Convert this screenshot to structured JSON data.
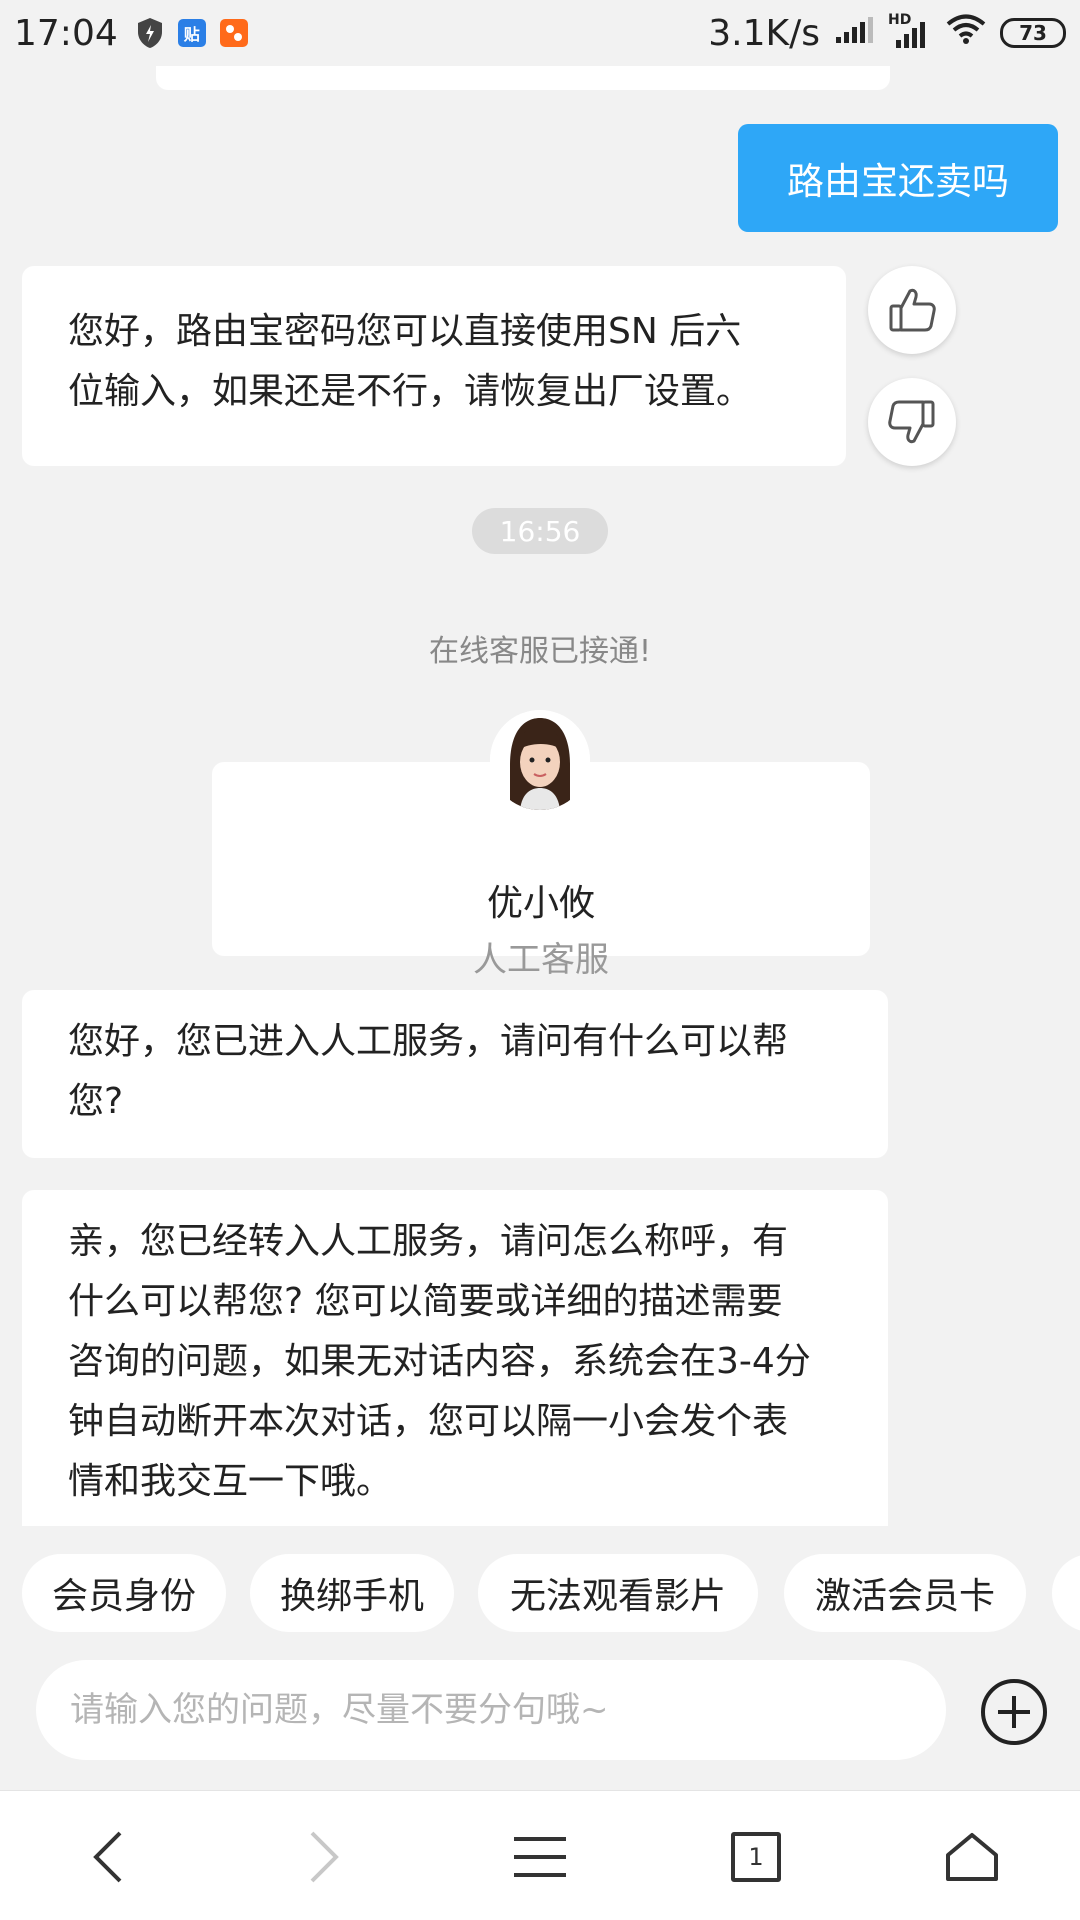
{
  "status_bar": {
    "time": "17:04",
    "network_speed": "3.1K/s",
    "battery": "73",
    "signal_label": "HD",
    "app_icons": [
      "shield-icon",
      "tieba-icon",
      "app-icon"
    ],
    "tieba_glyph": "贴"
  },
  "chat": {
    "user_message": "路由宝还卖吗",
    "bot_reply_line1": "您好，路由宝密码您可以直接使用SN 后六",
    "bot_reply_line2": "位输入，如果还是不行，请恢复出厂设置。",
    "timestamp": "16:56",
    "system_note": "在线客服已接通!",
    "agent": {
      "name": "优小攸",
      "role": "人工客服"
    },
    "agent_msg1_line1": "您好，您已进入人工服务，请问有什么可以帮",
    "agent_msg1_line2": "您?",
    "agent_msg2_lines": [
      " 亲，您已经转入人工服务，请问怎么称呼，有",
      "什么可以帮您? 您可以简要或详细的描述需要",
      "咨询的问题，如果无对话内容，系统会在3-4分",
      "钟自动断开本次对话，您可以隔一小会发个表",
      "情和我交互一下哦。"
    ]
  },
  "quick_replies": [
    "会员身份",
    "换绑手机",
    "无法观看影片",
    "激活会员卡"
  ],
  "input": {
    "placeholder": "请输入您的问题，尽量不要分句哦~"
  },
  "nav": {
    "tab_count": "1"
  },
  "colors": {
    "accent": "#2ea7f7",
    "background": "#f2f2f2",
    "card": "#ffffff"
  }
}
